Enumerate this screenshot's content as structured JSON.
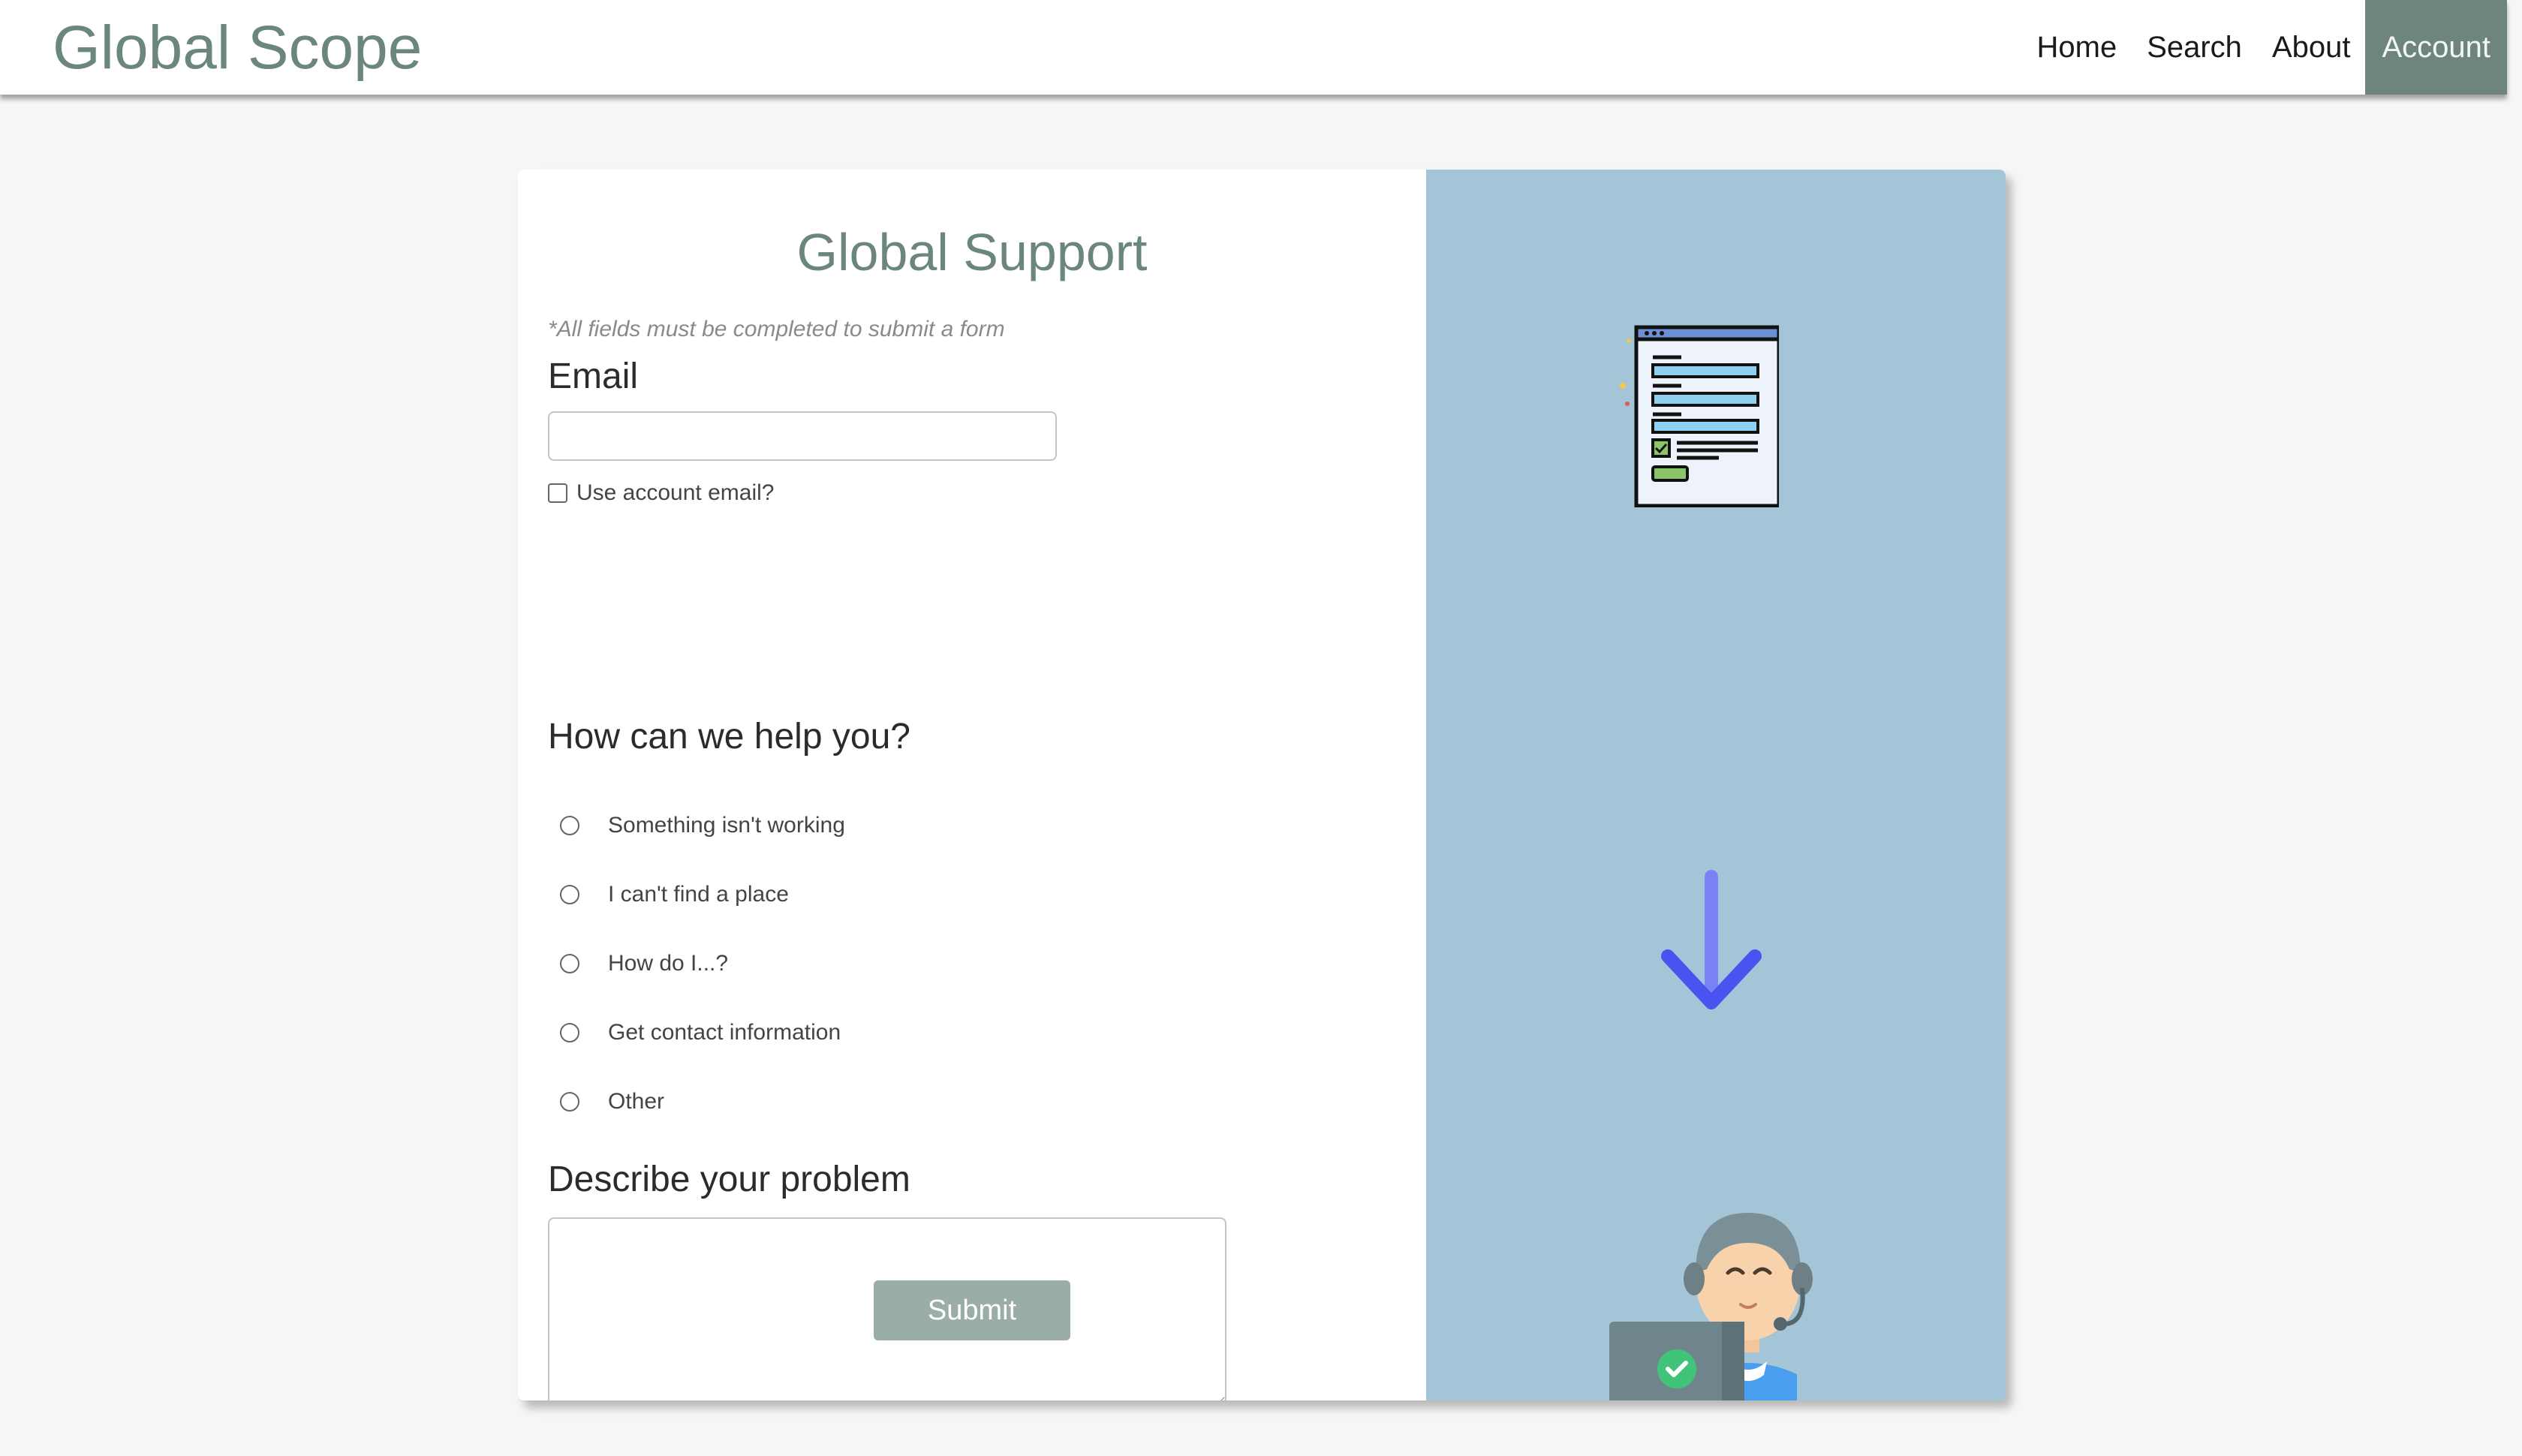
{
  "header": {
    "brand": "Global Scope",
    "nav": [
      {
        "label": "Home",
        "active": false
      },
      {
        "label": "Search",
        "active": false
      },
      {
        "label": "About",
        "active": false
      },
      {
        "label": "Account",
        "active": true
      }
    ]
  },
  "form": {
    "title": "Global Support",
    "note": "*All fields must be completed to submit a form",
    "email_label": "Email",
    "email_value": "",
    "use_account_email_label": "Use account email?",
    "use_account_email_checked": false,
    "help_label": "How can we help you?",
    "help_options": [
      "Something isn't working",
      "I can't find a place",
      "How do I...?",
      "Get contact information",
      "Other"
    ],
    "problem_label": "Describe your problem",
    "problem_value": "",
    "submit_label": "Submit"
  },
  "illustrations": {
    "top": "form-document-icon",
    "middle": "arrow-down-icon",
    "bottom": "support-agent-icon"
  },
  "colors": {
    "brand": "#6b857f",
    "active_nav_bg": "#6e857f",
    "illus_bg": "#a4c4d7",
    "submit_bg": "#9aada8",
    "arrow": "#5a64f2"
  }
}
